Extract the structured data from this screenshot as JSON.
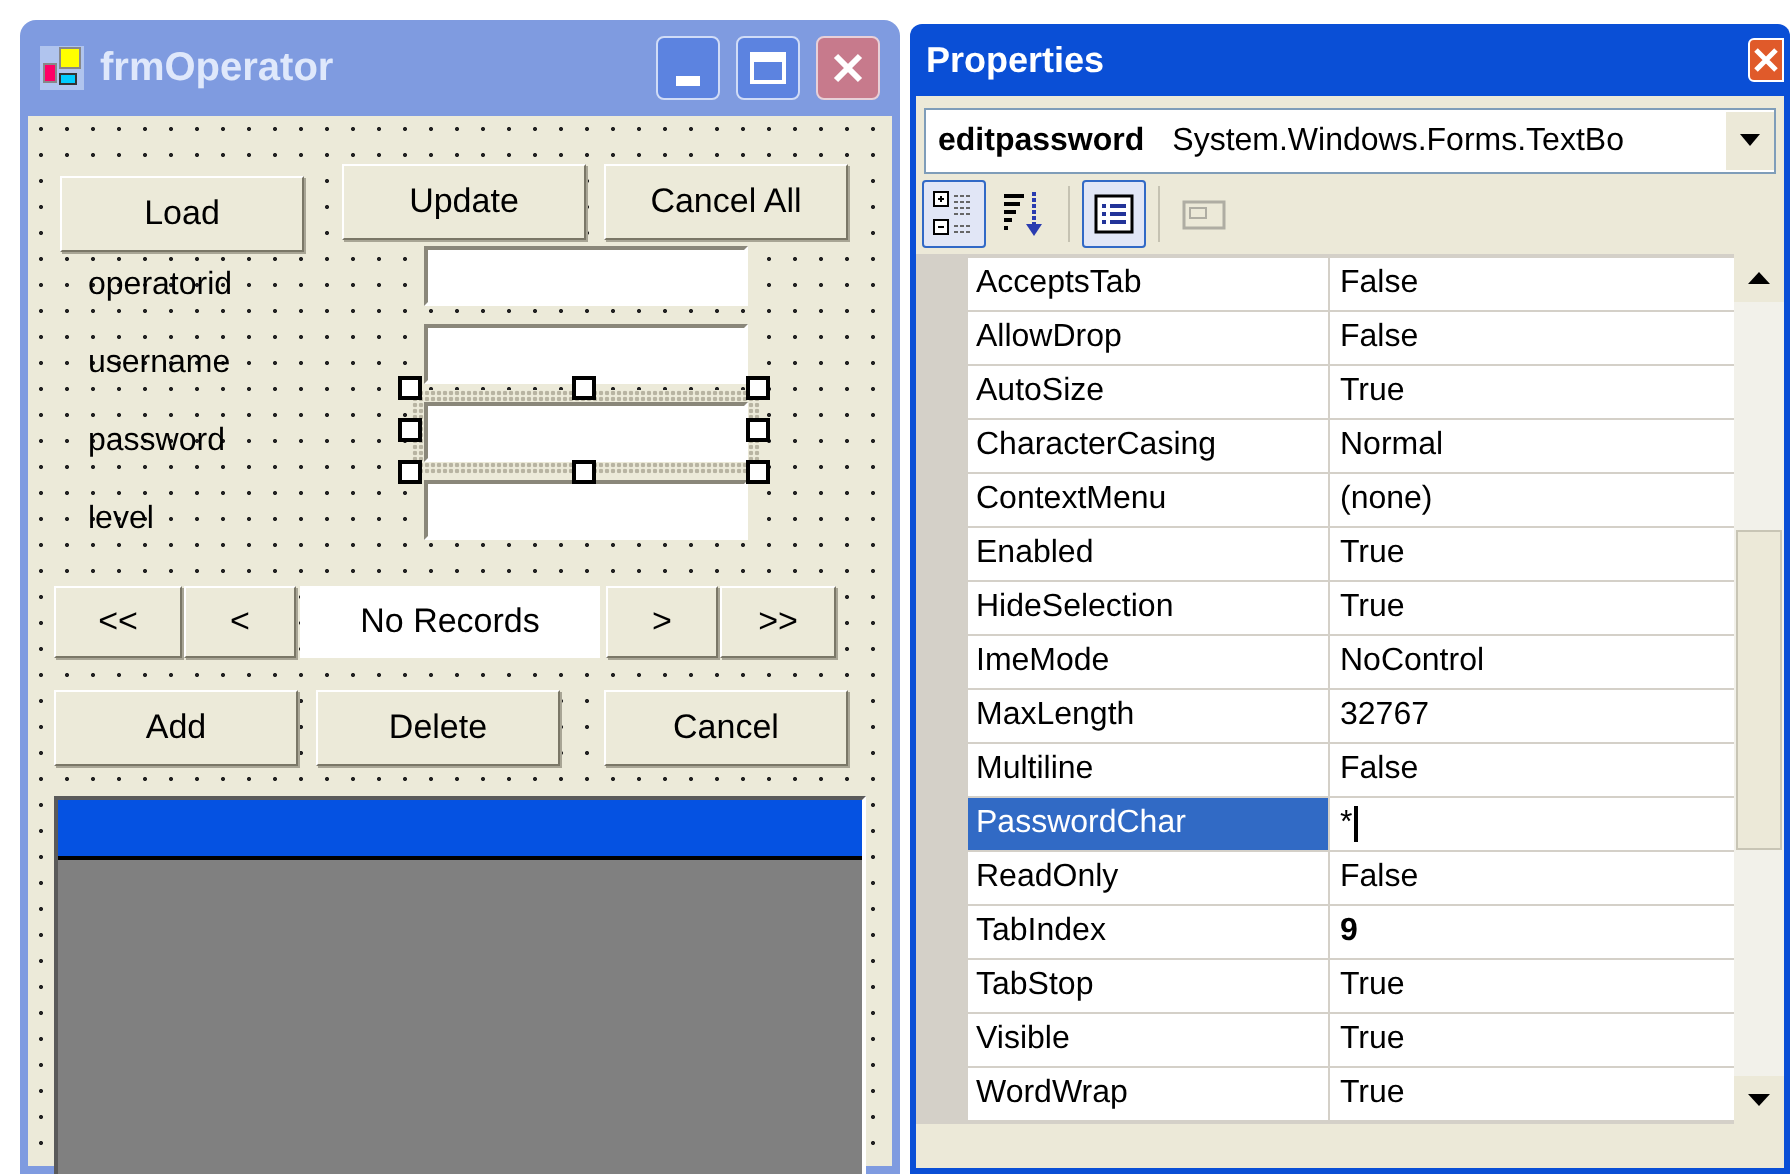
{
  "designer": {
    "title": "frmOperator",
    "top_buttons": [
      {
        "label": "Load"
      },
      {
        "label": "Update"
      },
      {
        "label": "Cancel All"
      }
    ],
    "fields": [
      {
        "label": "operatorid",
        "selected": false
      },
      {
        "label": "username",
        "selected": false
      },
      {
        "label": "password",
        "selected": true
      },
      {
        "label": "level",
        "selected": false
      }
    ],
    "navigator": {
      "first": "<<",
      "previous": "<",
      "status": "No Records",
      "next": ">",
      "last": ">>"
    },
    "bottom_buttons": [
      {
        "label": "Add"
      },
      {
        "label": "Delete"
      },
      {
        "label": "Cancel"
      }
    ]
  },
  "properties": {
    "title": "Properties",
    "object_name": "editpassword",
    "object_type": "System.Windows.Forms.TextBo",
    "toolbar": [
      {
        "kind": "categorized",
        "pressed": true,
        "disabled": false
      },
      {
        "kind": "alphabetical",
        "pressed": false,
        "disabled": false
      },
      {
        "kind": "properties",
        "pressed": true,
        "disabled": false
      },
      {
        "kind": "events",
        "pressed": false,
        "disabled": true
      }
    ],
    "rows": [
      {
        "name": "AcceptsTab",
        "value": "False",
        "selected": false,
        "modified": false
      },
      {
        "name": "AllowDrop",
        "value": "False",
        "selected": false,
        "modified": false
      },
      {
        "name": "AutoSize",
        "value": "True",
        "selected": false,
        "modified": false
      },
      {
        "name": "CharacterCasing",
        "value": "Normal",
        "selected": false,
        "modified": false
      },
      {
        "name": "ContextMenu",
        "value": "(none)",
        "selected": false,
        "modified": false
      },
      {
        "name": "Enabled",
        "value": "True",
        "selected": false,
        "modified": false
      },
      {
        "name": "HideSelection",
        "value": "True",
        "selected": false,
        "modified": false
      },
      {
        "name": "ImeMode",
        "value": "NoControl",
        "selected": false,
        "modified": false
      },
      {
        "name": "MaxLength",
        "value": "32767",
        "selected": false,
        "modified": false
      },
      {
        "name": "Multiline",
        "value": "False",
        "selected": false,
        "modified": false
      },
      {
        "name": "PasswordChar",
        "value": "*",
        "selected": true,
        "modified": false
      },
      {
        "name": "ReadOnly",
        "value": "False",
        "selected": false,
        "modified": false
      },
      {
        "name": "TabIndex",
        "value": "9",
        "selected": false,
        "modified": true
      },
      {
        "name": "TabStop",
        "value": "True",
        "selected": false,
        "modified": false
      },
      {
        "name": "Visible",
        "value": "True",
        "selected": false,
        "modified": false
      },
      {
        "name": "WordWrap",
        "value": "True",
        "selected": false,
        "modified": false
      }
    ]
  }
}
